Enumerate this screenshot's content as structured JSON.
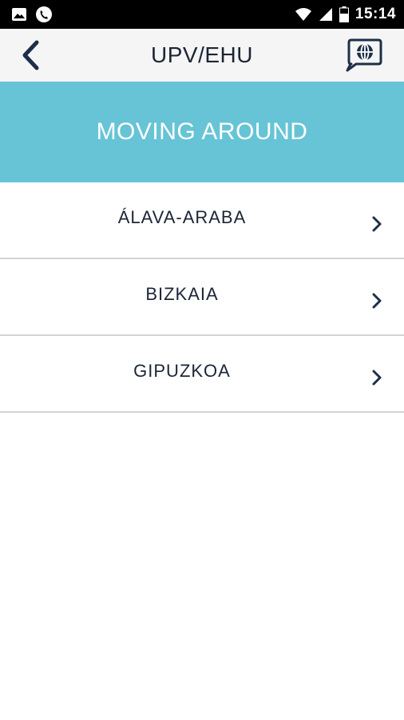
{
  "status_bar": {
    "time": "15:14",
    "icons": [
      "image-icon",
      "phone-call-icon",
      "wifi-icon",
      "signal-icon",
      "battery-icon"
    ]
  },
  "app_bar": {
    "title": "UPV/EHU",
    "back_icon": "chevron-left-icon",
    "lang_icon": "language-chat-icon"
  },
  "header": {
    "title": "MOVING AROUND"
  },
  "list": {
    "items": [
      {
        "label": "ÁLAVA-ARABA"
      },
      {
        "label": "BIZKAIA"
      },
      {
        "label": "GIPUZKOA"
      }
    ]
  },
  "colors": {
    "accent": "#66c4d6",
    "text_dark": "#1c2536",
    "status_bar": "#000000",
    "app_bar": "#f5f5f5",
    "divider": "#d3d3d3"
  }
}
